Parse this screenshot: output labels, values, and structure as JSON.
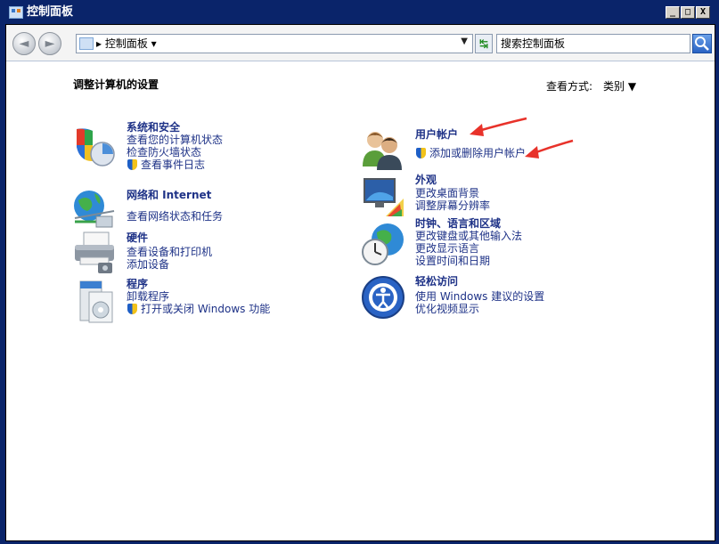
{
  "window": {
    "title": "控制面板",
    "min": "_",
    "max": "□",
    "close": "X"
  },
  "toolbar": {
    "back_glyph": "◄",
    "forward_glyph": "►",
    "address": "▸ 控制面板 ▾",
    "address_dropdown": "▼",
    "refresh_glyph": "↹",
    "search_placeholder": "搜索控制面板"
  },
  "page": {
    "title": "调整计算机的设置",
    "view_label": "查看方式:",
    "view_value": "类别 ▼"
  },
  "categories": [
    {
      "title": "系统和安全",
      "links": [
        "查看您的计算机状态",
        "检查防火墙状态",
        "查看事件日志"
      ],
      "icon": "system-security-icon"
    },
    {
      "title": "网络和 Internet",
      "links": [
        "查看网络状态和任务"
      ],
      "icon": "network-globe-icon"
    },
    {
      "title": "硬件",
      "links": [
        "查看设备和打印机",
        "添加设备"
      ],
      "icon": "printer-icon"
    },
    {
      "title": "程序",
      "links": [
        "卸载程序",
        "打开或关闭 Windows 功能"
      ],
      "icon": "programs-icon"
    },
    {
      "title": "用户帐户",
      "links": [
        "添加或删除用户帐户"
      ],
      "icon": "users-icon"
    },
    {
      "title": "外观",
      "links": [
        "更改桌面背景",
        "调整屏幕分辨率"
      ],
      "icon": "appearance-icon"
    },
    {
      "title": "时钟、语言和区域",
      "links": [
        "更改键盘或其他输入法",
        "更改显示语言",
        "设置时间和日期"
      ],
      "icon": "clock-globe-icon"
    },
    {
      "title": "轻松访问",
      "links": [
        "使用 Windows 建议的设置",
        "优化视频显示"
      ],
      "icon": "ease-of-access-icon"
    }
  ],
  "colors": {
    "link": "#1e3287",
    "title_bar": "#0a246a",
    "annotation_arrow": "#e8322a"
  }
}
